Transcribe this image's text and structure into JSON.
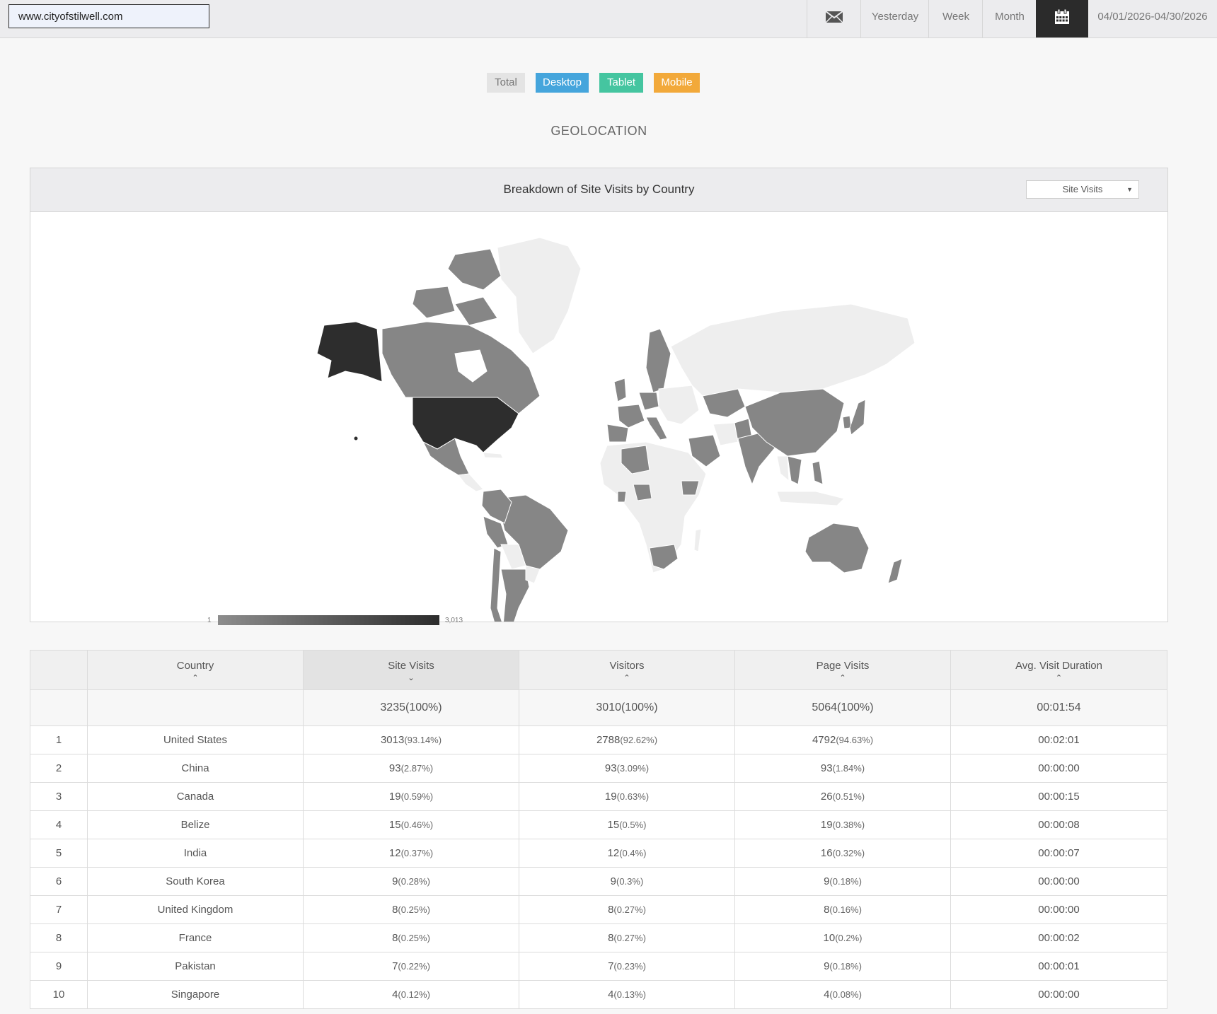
{
  "topbar": {
    "site": "www.cityofstilwell.com",
    "mail_icon": "envelope-icon",
    "yesterday": "Yesterday",
    "week": "Week",
    "month": "Month",
    "calendar_icon": "calendar-icon",
    "date_range": "04/01/2026-04/30/2026"
  },
  "filters": {
    "total": "Total",
    "desktop": "Desktop",
    "tablet": "Tablet",
    "mobile": "Mobile"
  },
  "colors": {
    "desktop": "#45a5dc",
    "tablet": "#45c5a0",
    "mobile": "#f2a93a",
    "dark": "#2b2b2b"
  },
  "section_title": "GEOLOCATION",
  "map_panel": {
    "title": "Breakdown of Site Visits by Country",
    "metric": "Site Visits",
    "legend_min": "1",
    "legend_max": "3,013"
  },
  "table": {
    "headers": [
      "",
      "Country",
      "Site Visits",
      "Visitors",
      "Page Visits",
      "Avg. Visit Duration"
    ],
    "sorted_column": "Site Visits",
    "totals": {
      "site_visits": "3235(100%)",
      "visitors": "3010(100%)",
      "page_visits": "5064(100%)",
      "duration": "00:01:54"
    },
    "rows": [
      {
        "rank": "1",
        "country": "United States",
        "sv": "3013",
        "sv_pct": "(93.14%)",
        "vi": "2788",
        "vi_pct": "(92.62%)",
        "pv": "4792",
        "pv_pct": "(94.63%)",
        "dur": "00:02:01"
      },
      {
        "rank": "2",
        "country": "China",
        "sv": "93",
        "sv_pct": "(2.87%)",
        "vi": "93",
        "vi_pct": "(3.09%)",
        "pv": "93",
        "pv_pct": "(1.84%)",
        "dur": "00:00:00"
      },
      {
        "rank": "3",
        "country": "Canada",
        "sv": "19",
        "sv_pct": "(0.59%)",
        "vi": "19",
        "vi_pct": "(0.63%)",
        "pv": "26",
        "pv_pct": "(0.51%)",
        "dur": "00:00:15"
      },
      {
        "rank": "4",
        "country": "Belize",
        "sv": "15",
        "sv_pct": "(0.46%)",
        "vi": "15",
        "vi_pct": "(0.5%)",
        "pv": "19",
        "pv_pct": "(0.38%)",
        "dur": "00:00:08"
      },
      {
        "rank": "5",
        "country": "India",
        "sv": "12",
        "sv_pct": "(0.37%)",
        "vi": "12",
        "vi_pct": "(0.4%)",
        "pv": "16",
        "pv_pct": "(0.32%)",
        "dur": "00:00:07"
      },
      {
        "rank": "6",
        "country": "South Korea",
        "sv": "9",
        "sv_pct": "(0.28%)",
        "vi": "9",
        "vi_pct": "(0.3%)",
        "pv": "9",
        "pv_pct": "(0.18%)",
        "dur": "00:00:00"
      },
      {
        "rank": "7",
        "country": "United Kingdom",
        "sv": "8",
        "sv_pct": "(0.25%)",
        "vi": "8",
        "vi_pct": "(0.27%)",
        "pv": "8",
        "pv_pct": "(0.16%)",
        "dur": "00:00:00"
      },
      {
        "rank": "8",
        "country": "France",
        "sv": "8",
        "sv_pct": "(0.25%)",
        "vi": "8",
        "vi_pct": "(0.27%)",
        "pv": "10",
        "pv_pct": "(0.2%)",
        "dur": "00:00:02"
      },
      {
        "rank": "9",
        "country": "Pakistan",
        "sv": "7",
        "sv_pct": "(0.22%)",
        "vi": "7",
        "vi_pct": "(0.23%)",
        "pv": "9",
        "pv_pct": "(0.18%)",
        "dur": "00:00:01"
      },
      {
        "rank": "10",
        "country": "Singapore",
        "sv": "4",
        "sv_pct": "(0.12%)",
        "vi": "4",
        "vi_pct": "(0.13%)",
        "pv": "4",
        "pv_pct": "(0.08%)",
        "dur": "00:00:00"
      }
    ]
  }
}
